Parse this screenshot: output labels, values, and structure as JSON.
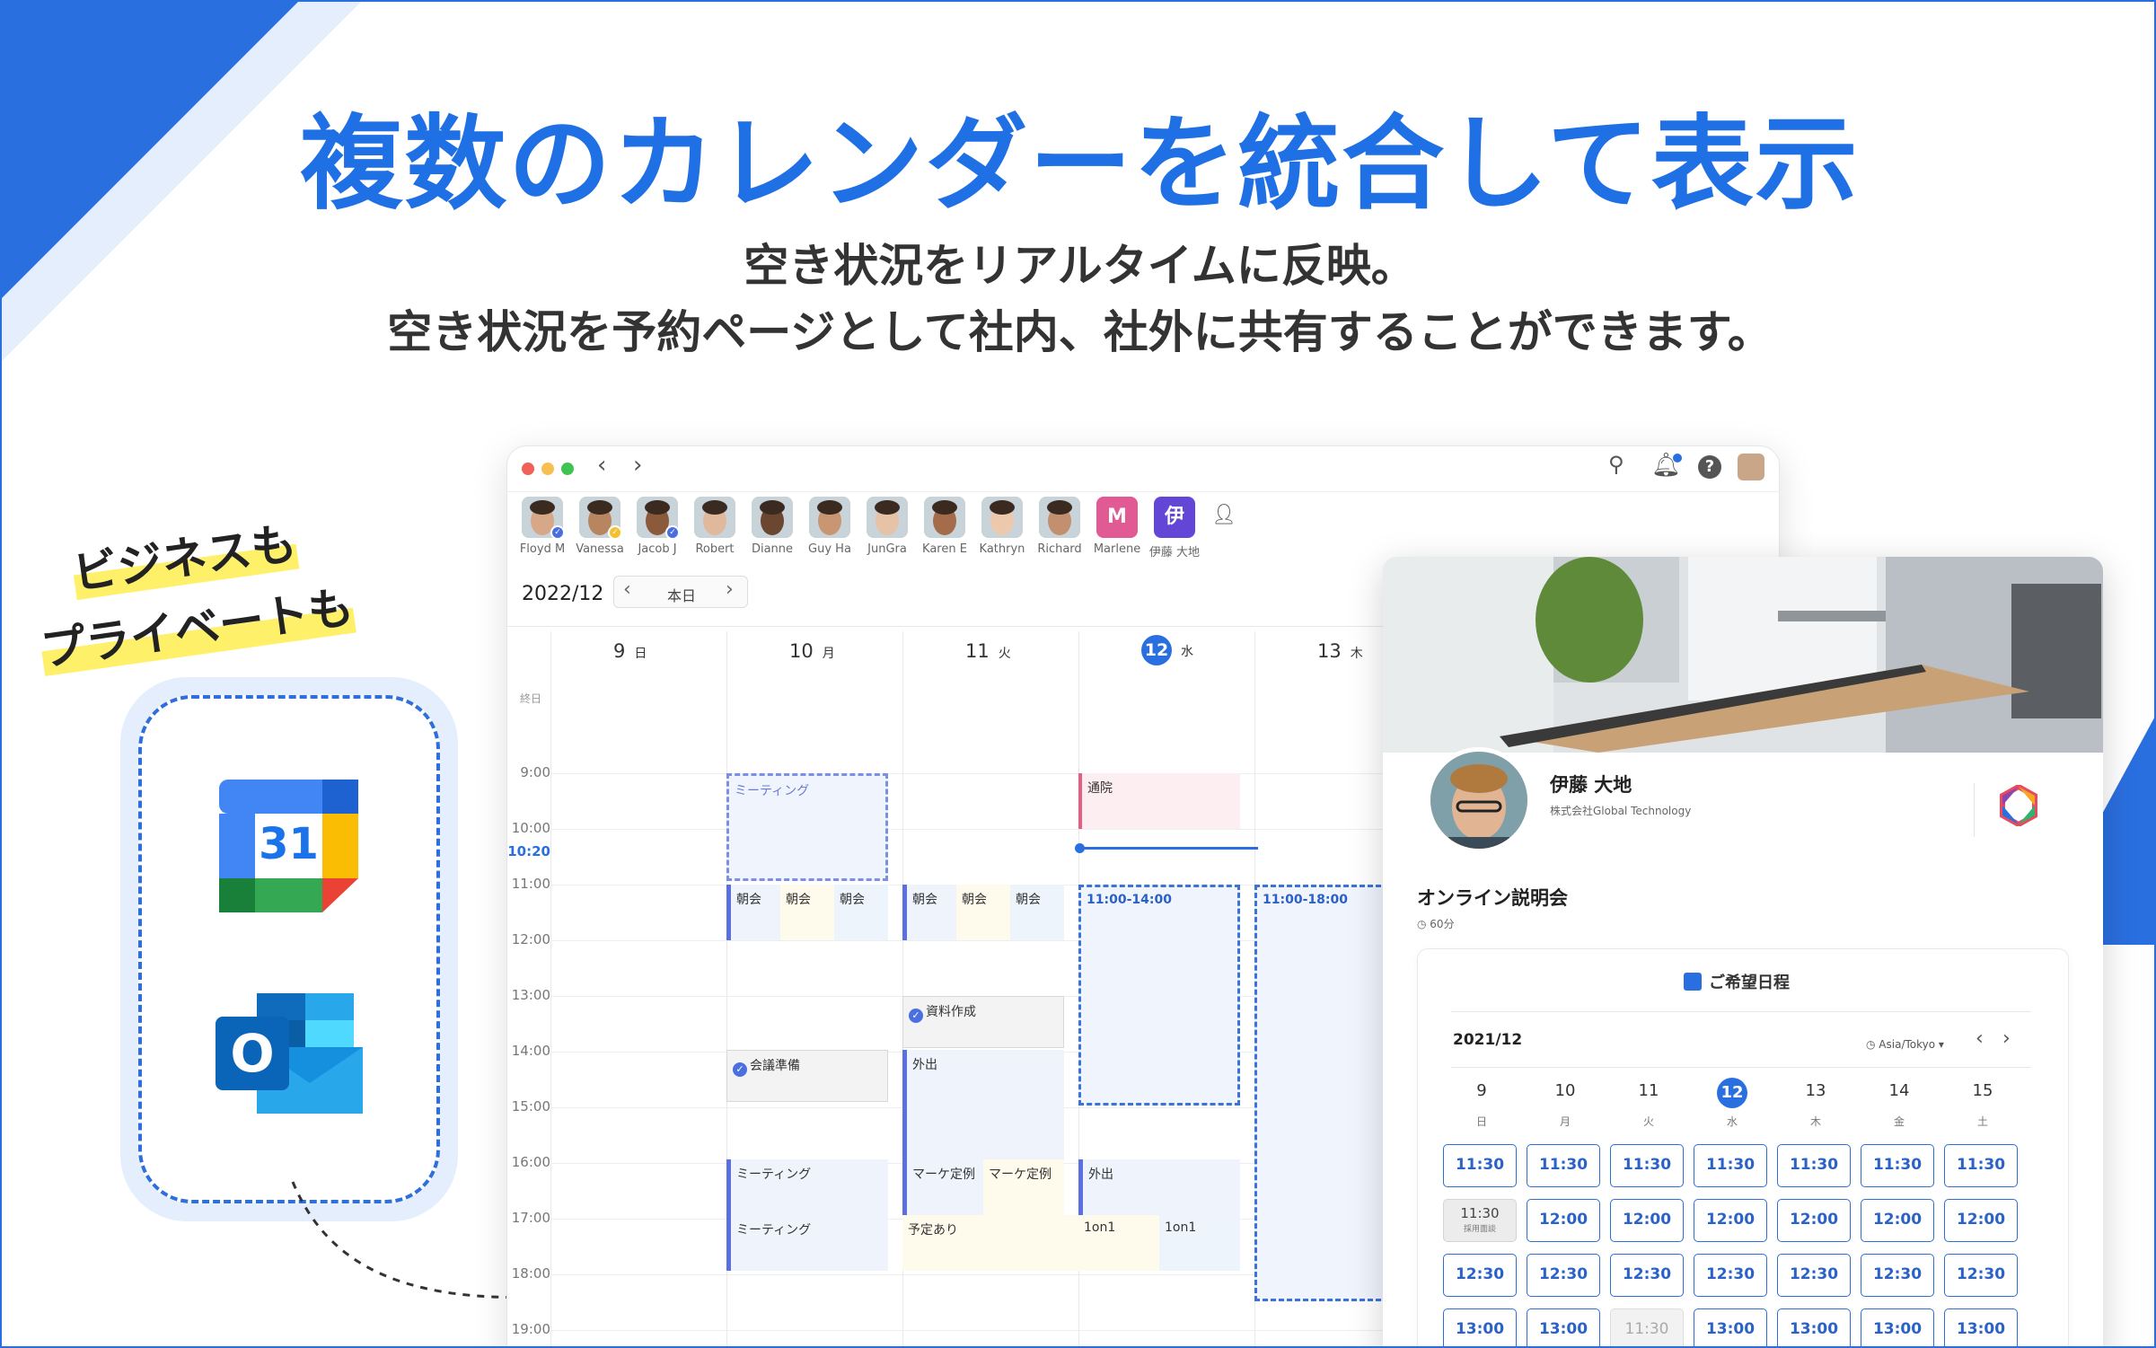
{
  "hero": {
    "title": "複数のカレンダーを統合して表示",
    "subtitle_line1": "空き状況をリアルタイムに反映。",
    "subtitle_line2": "空き状況を予約ページとして社内、社外に共有することができます。"
  },
  "side": {
    "tag_line1": "ビジネスも",
    "tag_line2": "プライベートも",
    "gcal_number": "31",
    "outlook_letter": "O"
  },
  "colors": {
    "accent": "#1f6fe5",
    "highlight": "#fff06a"
  },
  "app": {
    "members": [
      {
        "name": "Floyd M",
        "badge": "check"
      },
      {
        "name": "Vanessa",
        "badge": "check-yellow"
      },
      {
        "name": "Jacob J",
        "badge": "check"
      },
      {
        "name": "Robert"
      },
      {
        "name": "Dianne"
      },
      {
        "name": "Guy Ha"
      },
      {
        "name": "JunGra"
      },
      {
        "name": "Karen E"
      },
      {
        "name": "Kathryn"
      },
      {
        "name": "Richard"
      },
      {
        "name": "Marlene",
        "initial": "M",
        "color": "#e25a93"
      },
      {
        "name": "伊藤 大地",
        "initial": "伊",
        "color": "#6446d6"
      }
    ],
    "month": "2022/12",
    "today_label": "本日",
    "days": [
      {
        "num": "9",
        "wd": "日"
      },
      {
        "num": "10",
        "wd": "月"
      },
      {
        "num": "11",
        "wd": "火"
      },
      {
        "num": "12",
        "wd": "水",
        "today": true
      },
      {
        "num": "13",
        "wd": "木"
      }
    ],
    "allday_label": "終日",
    "times": [
      "9:00",
      "10:00",
      "11:00",
      "12:00",
      "13:00",
      "14:00",
      "15:00",
      "16:00",
      "17:00",
      "18:00",
      "19:00"
    ],
    "now_label": "10:20",
    "events": {
      "mon_meeting": "ミーティング",
      "tue_chokai": "朝会",
      "doc": "資料作成",
      "gaishutsu": "外出",
      "mon_prep": "会議準備",
      "marke": "マーケ定例",
      "mon_meeting2": "ミーティング",
      "mon_meeting3": "ミーティング",
      "yotei": "予定あり",
      "one_on_one": "1on1",
      "tsuin": "通院",
      "wed_gaishutsu": "外出",
      "range_wed": "11:00-14:00",
      "range_thu": "11:00-18:00"
    }
  },
  "booking": {
    "name": "伊藤 大地",
    "company": "株式会社Global Technology",
    "event_title": "オンライン説明会",
    "duration": "60分",
    "section_title": "ご希望日程",
    "month": "2021/12",
    "timezone": "Asia/Tokyo",
    "days": [
      {
        "num": "9",
        "wd": "日"
      },
      {
        "num": "10",
        "wd": "月"
      },
      {
        "num": "11",
        "wd": "火"
      },
      {
        "num": "12",
        "wd": "水",
        "today": true
      },
      {
        "num": "13",
        "wd": "木"
      },
      {
        "num": "14",
        "wd": "金"
      },
      {
        "num": "15",
        "wd": "土"
      }
    ],
    "slots": [
      [
        "11:30",
        "11:30",
        "11:30",
        "11:30",
        "11:30",
        "11:30",
        "11:30"
      ],
      [
        "11:30",
        "12:00",
        "12:00",
        "12:00",
        "12:00",
        "12:00",
        "12:00"
      ],
      [
        "12:30",
        "12:30",
        "12:30",
        "12:30",
        "12:30",
        "12:30",
        "12:30"
      ],
      [
        "13:00",
        "13:00",
        "11:30",
        "13:00",
        "13:00",
        "13:00",
        "13:00"
      ]
    ],
    "busy_label": "採用面談"
  }
}
